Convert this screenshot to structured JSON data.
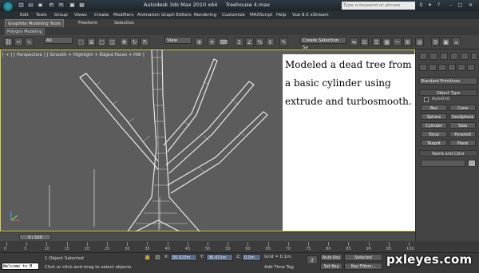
{
  "title": {
    "app": "Autodesk 3ds Max  2010 x64",
    "file": "Treehouse 4.max"
  },
  "search_placeholder": "Type a keyword or phrase",
  "menu": [
    "Edit",
    "Tools",
    "Group",
    "Views",
    "Create",
    "Modifiers",
    "Animation",
    "Graph Editors",
    "Rendering",
    "Customize",
    "MAXScript",
    "Help",
    "Vue 8.5 xStream"
  ],
  "ribbon": {
    "tabs": [
      "Graphite Modeling Tools",
      "Freeform",
      "Selection"
    ],
    "subtab": "Polygon Modeling"
  },
  "main_toolbar": {
    "filter": "All",
    "ref_coord": "View",
    "selection_set": "Create Selection Se",
    "snap_number": "3",
    "percent_snap": "%"
  },
  "viewport": {
    "label": "[ + ] [ Perspective ] [ Smooth + Highlight + Edged Faces + HW ]"
  },
  "overlay_note": "Modeled a dead tree from a basic cylinder using extrude and turbosmooth.",
  "command_panel": {
    "dropdown": "Standard Primitives",
    "object_type": "Object Type",
    "autogrid": "AutoGrid",
    "buttons": [
      "Box",
      "Cone",
      "Sphere",
      "GeoSphere",
      "Cylinder",
      "Tube",
      "Torus",
      "Pyramid",
      "Teapot",
      "Plane"
    ],
    "name_and_color": "Name and Color"
  },
  "timeline": {
    "frame": "0 / 100",
    "ticks": [
      "0",
      "5",
      "10",
      "15",
      "20",
      "25",
      "30",
      "35",
      "40",
      "45",
      "50",
      "55",
      "60",
      "65",
      "70",
      "75",
      "80",
      "85",
      "90",
      "95",
      "100"
    ]
  },
  "status": {
    "maxscript": "Welcome to M",
    "selected": "1 Object Selected",
    "prompt": "Click or click-and-drag to select objects",
    "x_label": "X:",
    "x": "30.023m",
    "y_label": "Y:",
    "y": "36.415m",
    "z_label": "Z:",
    "z": "0.0m",
    "grid": "Grid = 0.1m",
    "add_time_tag": "Add Time Tag",
    "auto_key": "Auto Key",
    "selected_dd": "Selected",
    "set_key": "Set Key",
    "key_filters": "Key Filters..."
  },
  "watermark": "pxleyes.com",
  "colors": {
    "viewport_border": "#d9d050",
    "wire": "#f2f2f2",
    "panel": "#444444"
  }
}
